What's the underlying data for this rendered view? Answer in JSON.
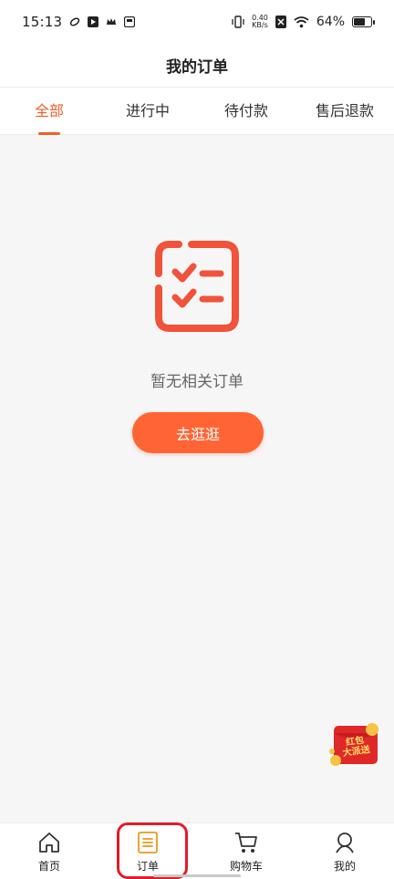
{
  "status_bar": {
    "time": "15:13",
    "net_speed_value": "0.40",
    "net_speed_unit": "KB/s",
    "battery": "64%"
  },
  "header": {
    "title": "我的订单"
  },
  "tabs": [
    {
      "label": "全部",
      "active": true
    },
    {
      "label": "进行中",
      "active": false
    },
    {
      "label": "待付款",
      "active": false
    },
    {
      "label": "售后退款",
      "active": false
    }
  ],
  "empty_state": {
    "message": "暂无相关订单",
    "button_label": "去逛逛",
    "icon": "order-checklist-icon"
  },
  "red_packet": {
    "text_line1": "红包",
    "text_line2": "大派送"
  },
  "bottom_nav": [
    {
      "label": "首页",
      "icon": "home-icon"
    },
    {
      "label": "订单",
      "icon": "order-icon",
      "active": true
    },
    {
      "label": "购物车",
      "icon": "cart-icon"
    },
    {
      "label": "我的",
      "icon": "profile-icon"
    }
  ],
  "colors": {
    "accent": "#ef5f2b",
    "button": "#ff6534",
    "highlight_box": "#e21c2a",
    "order_icon": "#e89a1b"
  }
}
